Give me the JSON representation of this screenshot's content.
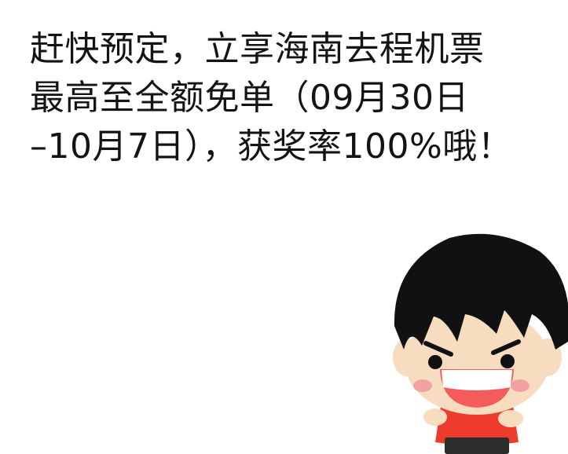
{
  "message": {
    "lines": [
      "赶快预定，立享海南去程机票",
      "最高至全额免单（09月30日",
      "–10月7日），获奖率100%哦！"
    ]
  },
  "sticker": {
    "icon": "cartoon-boy-grinning-sticker",
    "colors": {
      "hair": "#111111",
      "skin": "#f8dcc0",
      "cheeks": "#f2a2a3",
      "mouth": "#f45b5b",
      "shirt": "#ef3b2c",
      "pants": "#2d2d2d"
    }
  }
}
